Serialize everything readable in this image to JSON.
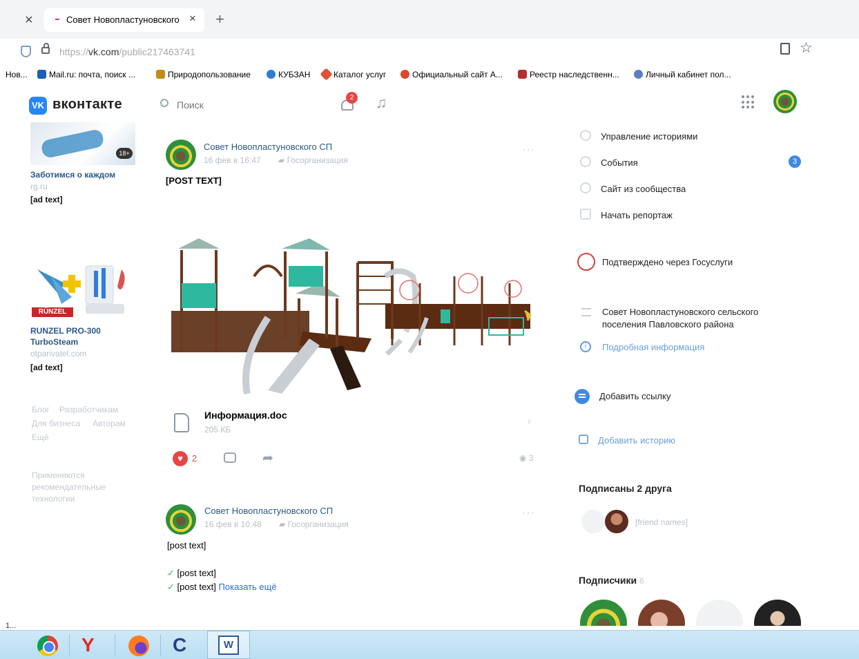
{
  "browser": {
    "tab_close": "×",
    "tab_title": "Совет Новопластуновского с",
    "tab_new": "+",
    "url_prefix": "https://",
    "url_host": "vk.com",
    "url_path": "/public217463741",
    "bookmarks": [
      {
        "label": "Нов...",
        "color": "#ffffff"
      },
      {
        "label": "Mail.ru: почта, поиск ...",
        "color": "#1a5fb4"
      },
      {
        "label": "Природопользование",
        "color": "#c58b1a"
      },
      {
        "label": "КУБЗАН",
        "color": "#2e7bd6"
      },
      {
        "label": "Каталог услуг",
        "color": "#e2523a"
      },
      {
        "label": "Официальный сайт А...",
        "color": "#d84a2a"
      },
      {
        "label": "Реестр наследственн...",
        "color": "#b03030"
      },
      {
        "label": "Личный кабинет пол...",
        "color": "#5a7fc2"
      }
    ]
  },
  "vk": {
    "logo_mark": "VK",
    "brand": "вконтакте",
    "search_placeholder": "Поиск",
    "notifications_count": "2",
    "music_glyph": "♫"
  },
  "left": {
    "ad1": {
      "badge": "18+",
      "title": "Заботимся о каждом",
      "source": "rg.ru",
      "text": "[ad text]"
    },
    "ad2": {
      "brand_mark": "RÜNZEL",
      "title": "RUNZEL PRO-300",
      "subtitle": "TurboSteam",
      "source": "otparivatel.com",
      "text": "[ad text]"
    },
    "footer": {
      "blog": "Блог",
      "developers": "Разработчикам",
      "business": "Для бизнеса",
      "authors": "Авторам",
      "more": "Ещё"
    },
    "recommendation": "Применяются рекомендательные технологии"
  },
  "post1": {
    "author": "Совет Новопластуновского СП",
    "date": "16 фев в 16:47",
    "org": "Госорганизация",
    "more": "···",
    "heading": "[post text]",
    "doc_name": "Информация.doc",
    "doc_size": "205 КБ",
    "doc_chevron": "›",
    "likes": "2",
    "views": "3",
    "like_glyph": "♥",
    "share_glyph": "➦"
  },
  "post2": {
    "author": "Совет Новопластуновского СП",
    "date": "16 фев в 10:48",
    "org": "Госорганизация",
    "more": "···",
    "intro": "[post text]",
    "check1": "[post text]",
    "check2": "[post text]",
    "show_more": "Показать ещё",
    "check_glyph": "✓"
  },
  "right": {
    "menu": [
      {
        "label": "Управление историями"
      },
      {
        "label": "События",
        "badge": "3"
      },
      {
        "label": "Сайт из сообщества"
      },
      {
        "label": "Начать репортаж"
      }
    ],
    "gosuslugi": "Подтверждено через Госуслуги",
    "community_name": "Совет Новопластуновского сельского поселения Павловского района",
    "more_info": "Подробная информация",
    "info_glyph": "i",
    "add_link": "Добавить ссылку",
    "add_story": "Добавить историю",
    "friends_title": "Подписаны 2 друга",
    "friends_names": "[friend names]",
    "subscribers_title": "Подписчики",
    "subscribers_count": "6"
  },
  "os": {
    "clock_stub": "1...",
    "yandex_glyph": "Y",
    "ccleaner_glyph": "C",
    "word_glyph": "W"
  }
}
